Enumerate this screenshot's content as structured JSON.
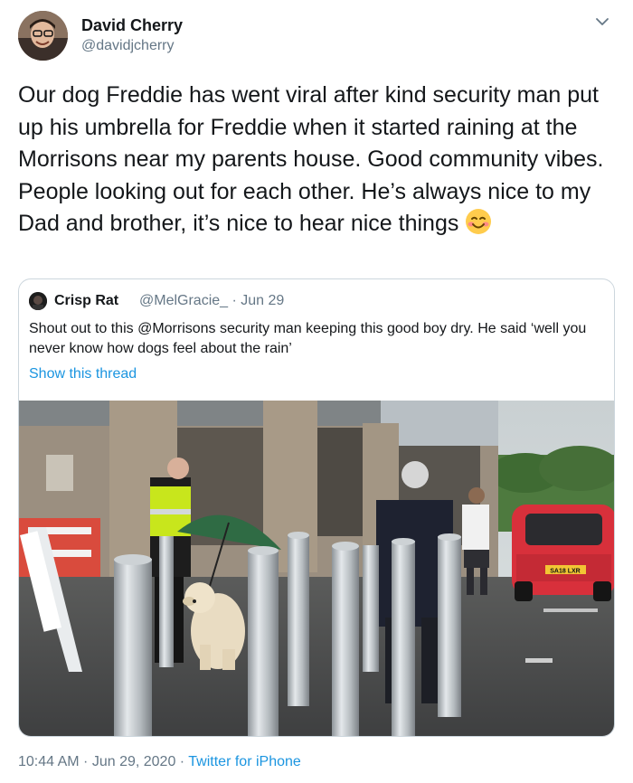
{
  "tweet": {
    "author_name": "David Cherry",
    "author_handle": "@davidjcherry",
    "text": "Our dog Freddie has went viral after kind security man put up his umbrella for Freddie when it started raining at the Morrisons near my parents house. Good community vibes. People looking out for each other. He’s always nice to my Dad and brother, it’s nice to hear nice things",
    "emoji": "smiling-face-with-smiling-eyes-icon",
    "timestamp": "10:44 AM · Jun 29, 2020 · ",
    "source": "Twitter for iPhone"
  },
  "quoted_tweet": {
    "author_name": "Crisp Rat",
    "author_handle": "@MelGracie_ · Jun 29",
    "text": "Shout out to this @Morrisons security man keeping this good boy dry. He said ‘well you never know how dogs feel about the rain’",
    "show_thread": "Show this thread",
    "photo_plate": "SA18 LXR"
  },
  "icons": {
    "caret": "chevron-down-icon"
  },
  "colors": {
    "link": "#1b95e0",
    "text": "#14171a",
    "secondary": "#657786",
    "border": "#ccd6dd"
  }
}
